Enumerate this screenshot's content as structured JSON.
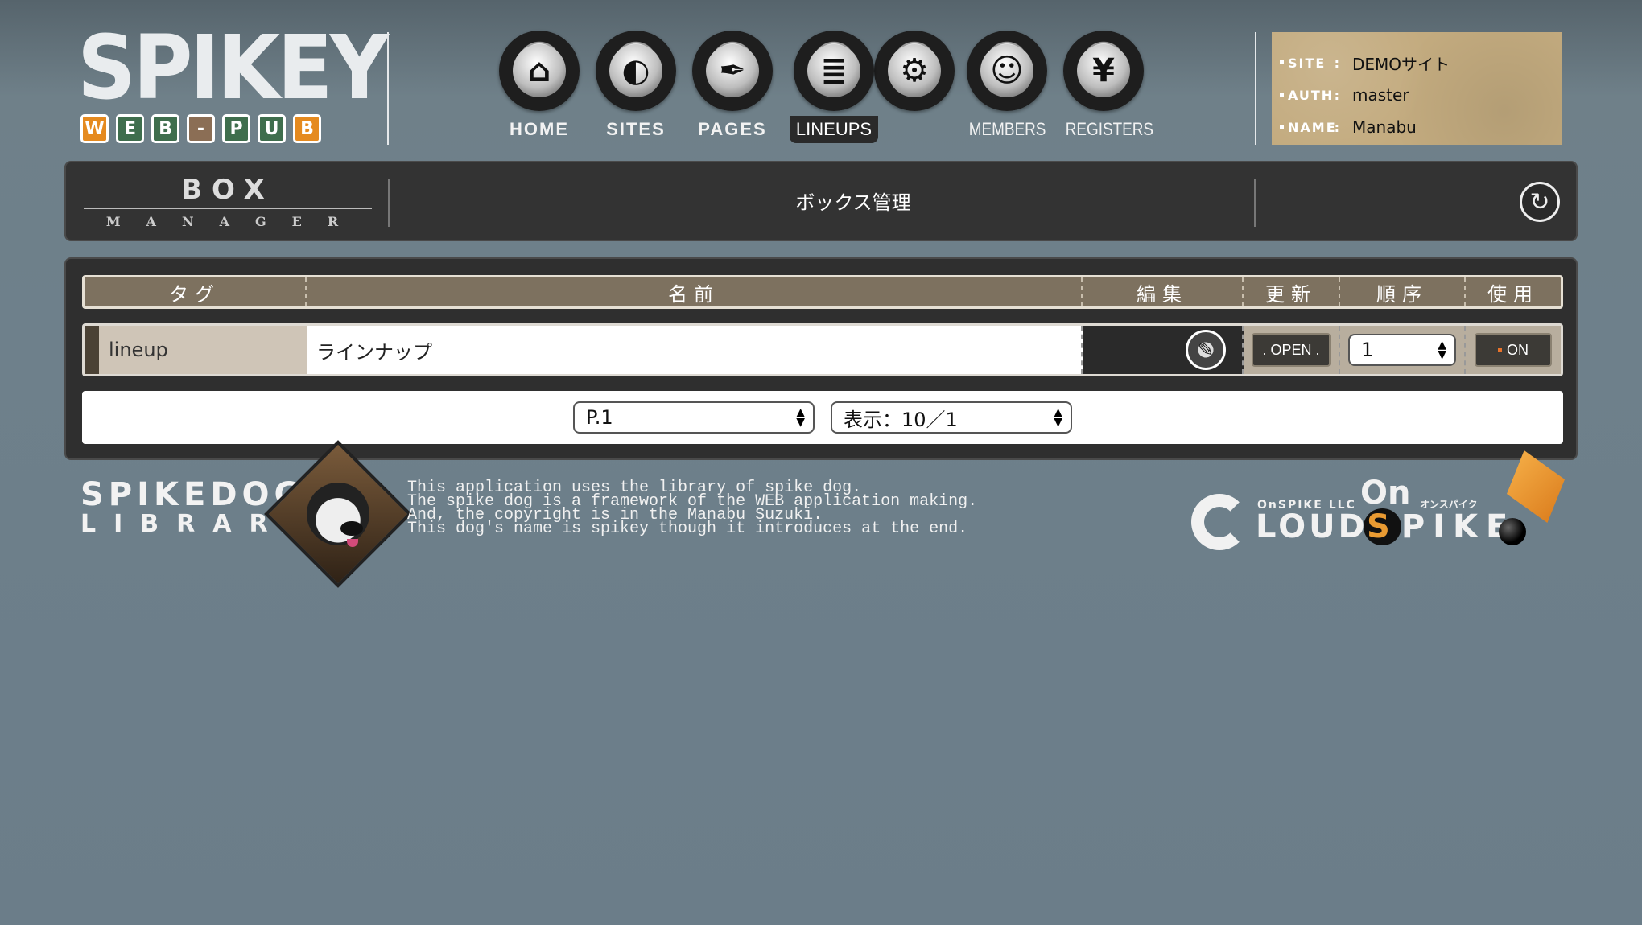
{
  "header": {
    "logo": {
      "title": "SPIKEY",
      "badges": [
        {
          "letter": "W",
          "color": "#e58a1f"
        },
        {
          "letter": "E",
          "color": "#3f6e4d"
        },
        {
          "letter": "B",
          "color": "#3f6e4d"
        },
        {
          "letter": "-",
          "color": "#8b6e55"
        },
        {
          "letter": "P",
          "color": "#3f6e4d"
        },
        {
          "letter": "U",
          "color": "#3f6e4d"
        },
        {
          "letter": "B",
          "color": "#e58a1f"
        }
      ],
      "subtitle": "WEB-PUB"
    },
    "nav": [
      {
        "label": "HOME",
        "icon": "home-icon"
      },
      {
        "label": "SITES",
        "icon": "globe-icon"
      },
      {
        "label": "PAGES",
        "icon": "pen-nib-icon"
      },
      {
        "label": "LINEUPS",
        "icon": "stack-icon",
        "active": true
      },
      {
        "label": "",
        "icon": "gear-icon"
      },
      {
        "label": "MEMBERS",
        "icon": "smiley-icon"
      },
      {
        "label": "REGISTERS",
        "icon": "yen-icon"
      }
    ],
    "info": {
      "site_key": "SITE",
      "site_val": "DEMOサイト",
      "auth_key": "AUTH",
      "auth_val": "master",
      "name_key": "NAME",
      "name_val": "Manabu"
    }
  },
  "manager": {
    "box_big": "BOX",
    "box_small": "MANAGER",
    "title": "ボックス管理",
    "refresh_icon": "refresh-icon"
  },
  "table": {
    "headers": [
      "タグ",
      "名前",
      "編集",
      "更新",
      "順序",
      "使用"
    ],
    "rows": [
      {
        "tag": "lineup",
        "name": "ラインナップ",
        "open": ". OPEN .",
        "order": "1",
        "use": "ON"
      }
    ],
    "pager": {
      "page": "P.1",
      "display": "表示：10／1"
    }
  },
  "footer": {
    "library_line1": "SPIKEDOG",
    "library_line2": "LIBRARY",
    "text": [
      "This application uses the library of spike dog.",
      "The spike dog is a framework of the WEB application making.",
      "And, the copyright is in the Manabu Suzuki.",
      "This dog's name is spikey though it introduces at the end."
    ],
    "cloud": {
      "small": "OnSPIKE LLC",
      "loud": "LOUD",
      "on": "On",
      "kana": "オンスパイク",
      "spike_s": "S",
      "spike_rest": "PIKE"
    }
  },
  "colors": {
    "accent_orange": "#e58a1f",
    "header_tan": "#7d715f",
    "panel_dark": "#2f2f2f",
    "background": "#6b7d89"
  }
}
